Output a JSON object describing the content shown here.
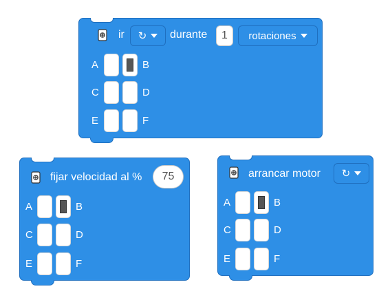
{
  "block1": {
    "label_ir": "ir",
    "direction_value": "↻",
    "label_durante": "durante",
    "amount": "1",
    "unit": "rotaciones",
    "ports": [
      "A",
      "B",
      "C",
      "D",
      "E",
      "F"
    ],
    "selected_port": "B"
  },
  "block2": {
    "label": "fijar velocidad al %",
    "value": "75",
    "ports": [
      "A",
      "B",
      "C",
      "D",
      "E",
      "F"
    ],
    "selected_port": "B"
  },
  "block3": {
    "label": "arrancar motor",
    "direction_value": "↻",
    "ports": [
      "A",
      "B",
      "C",
      "D",
      "E",
      "F"
    ],
    "selected_port": "B"
  },
  "colors": {
    "block_fill": "#2e8fe6",
    "block_border": "#1f6fbf",
    "selected_port": "#565656"
  },
  "icons": {
    "motor": "motor-icon",
    "direction": "clockwise-arrow-icon",
    "caret": "caret-down-icon"
  }
}
